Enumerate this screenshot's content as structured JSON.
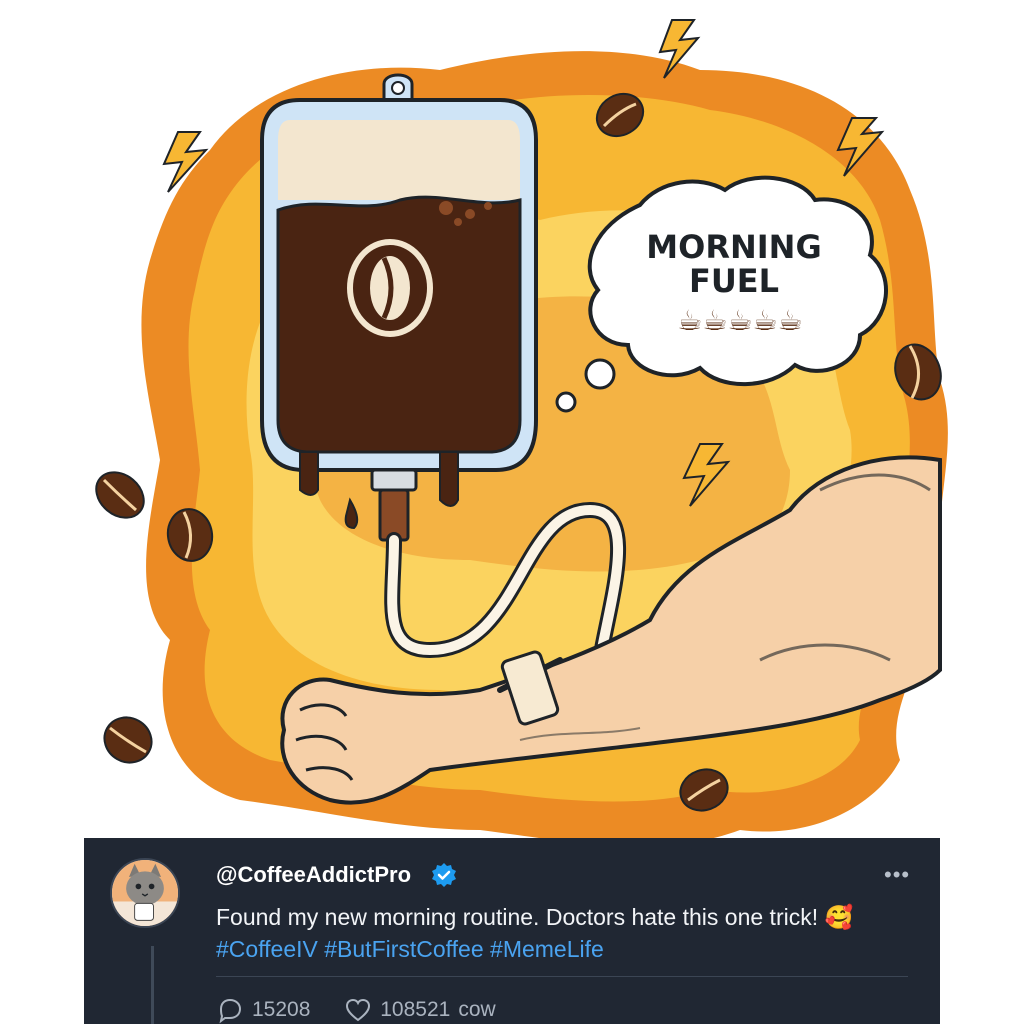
{
  "illustration": {
    "bubble_title_line1": "MORNING",
    "bubble_title_line2": "FUEL",
    "bubble_cups": "☕☕☕☕☕"
  },
  "post": {
    "handle": "@CoffeeAddictPro",
    "text": "Found my new morning routine. Doctors hate this one trick!",
    "emoji": "🥰",
    "hashtags": "#CoffeeIV #ButFirstCoffee #MemeLife",
    "more_label": "•••",
    "replies": "15208",
    "likes": "108521",
    "likes_suffix": "cow"
  },
  "colors": {
    "background_blob": "#f7b733",
    "blob_inner": "#fbd35f",
    "blob_edge": "#ec8b24",
    "coffee": "#4a2412",
    "bag_outline": "#1e2328",
    "panel_bg": "#202733",
    "hashtag": "#4aa3f0",
    "verified": "#1d9bf0"
  }
}
